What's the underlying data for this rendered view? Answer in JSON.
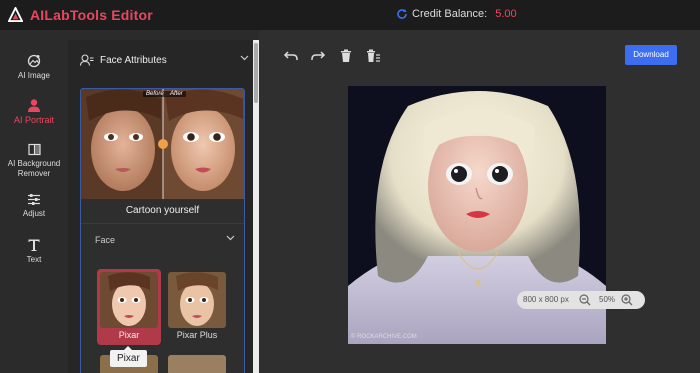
{
  "app": {
    "title": "AILabTools Editor"
  },
  "credit": {
    "label": "Credit Balance:",
    "value": "5.00"
  },
  "rail": [
    {
      "label": "AI Image",
      "icon": "ai-image-icon"
    },
    {
      "label": "AI Portrait",
      "icon": "portrait-icon"
    },
    {
      "label_line1": "AI Background",
      "label_line2": "Remover",
      "icon": "background-remover-icon"
    },
    {
      "label": "Adjust",
      "icon": "sliders-icon"
    },
    {
      "label": "Text",
      "icon": "text-icon"
    }
  ],
  "panel": {
    "section": "Face Attributes",
    "hero": {
      "before": "Before",
      "after": "After",
      "caption": "Cartoon yourself"
    },
    "face_label": "Face",
    "styles": [
      {
        "label": "Pixar",
        "selected": true
      },
      {
        "label": "Pixar Plus",
        "selected": false
      }
    ],
    "tooltip": "Pixar"
  },
  "toolbar": {
    "download": "Download"
  },
  "canvas": {
    "watermark": "© ROCKARCHIVE.COM"
  },
  "zoom": {
    "size": "800 x 800 px",
    "percent": "50%"
  },
  "colors": {
    "accent": "#e8485f",
    "primary": "#3d6ef0"
  }
}
